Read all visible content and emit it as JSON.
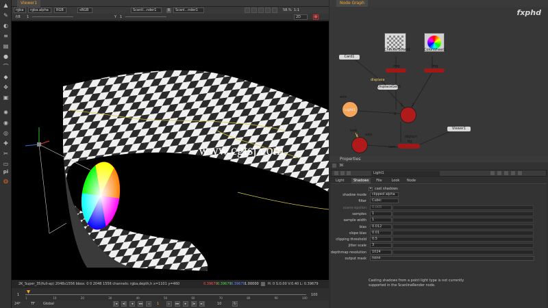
{
  "toolbar": {
    "icons": [
      "pointer-icon",
      "brush-icon",
      "palette-icon",
      "channel-icon",
      "gradient-icon",
      "sphere-icon",
      "curve-icon",
      "merge-icon",
      "transform-icon",
      "3d-icon",
      "particle-icon",
      "deep-icon",
      "views-icon",
      "metadata-icon",
      "toolsets-icon",
      "other-icon",
      "pi-icon",
      "nuke-icon"
    ]
  },
  "viewer": {
    "tab_label": "Viewer1",
    "controls": {
      "layer": "rgba",
      "channel": "rgba.alpha",
      "display": "RGB",
      "colorspace": "sRGB",
      "input_a": "ScanlI...nder1",
      "input_b_letter": "B",
      "input_b": "Scanl...nder1",
      "zoom_label": "58.%",
      "scale": "1:1",
      "gain_label": "f/8",
      "gain_value": "1",
      "gamma_label": "Y",
      "gamma_value": "1",
      "view_mode": "2D"
    },
    "info_bar": {
      "format": "2K_Super_35(full-ap) 2048x1556  bbox: 0 0 2048 1556 channels: rgba,depth,h  x=1101 y=460",
      "r": "0.39679",
      "g": "0.39679",
      "b": "0.39679",
      "a": "1.00000",
      "hsv": "H:   0 S:0.00 V:0.40  L: 0.39679"
    },
    "watermark": "www.cgtsj.com"
  },
  "timeline": {
    "ticks": [
      "1",
      "10",
      "20",
      "30",
      "40",
      "50",
      "60",
      "70",
      "80",
      "90",
      "100"
    ],
    "start": "1",
    "end": "100",
    "fps": "24*",
    "tf": "TF",
    "global": "Global",
    "frame": "1",
    "step": "10"
  },
  "node_graph": {
    "tab_label": "Node Graph",
    "brand": "fxphd",
    "nodes": {
      "noise": "Noise1",
      "checkerboard": "CheckerBoard1",
      "colorwheel": "ColorWheel1",
      "card": "Card1",
      "displace": "DisplaceGeo1",
      "img1": "img",
      "img2": "img",
      "light": "Light1",
      "axis": "axis",
      "look": "look",
      "scene": "Scene1",
      "render": "ScanlineRender1",
      "viewer": "Viewer1"
    },
    "labels": {
      "displace": "displace",
      "obj_scn": "obj/scn",
      "bg": "bg",
      "cam": "cam",
      "num1": "1",
      "num2": "2",
      "num3": "3",
      "num0": "0"
    }
  },
  "properties": {
    "tab_label": "Properties",
    "count": "3K",
    "node_name": "Light1",
    "tabs": [
      "Light",
      "Shadows",
      "File",
      "Look",
      "Node"
    ],
    "active_tab": "Shadows",
    "cast_shadows_label": "cast shadows",
    "cast_shadows": true,
    "rows": [
      {
        "label": "shadow mode",
        "value": "clipped alpha",
        "kind": "dropdown"
      },
      {
        "label": "filter",
        "value": "Cubic",
        "kind": "dropdown"
      },
      {
        "label": "scene epsilon",
        "value": "0.005",
        "kind": "slider",
        "disabled": true
      },
      {
        "label": "samples",
        "value": "1",
        "kind": "slider"
      },
      {
        "label": "sample width",
        "value": "1",
        "kind": "slider"
      },
      {
        "label": "bias",
        "value": "0.012",
        "kind": "slider"
      },
      {
        "label": "slope bias",
        "value": "0.01",
        "kind": "slider"
      },
      {
        "label": "clipping threshold",
        "value": "0.5",
        "kind": "slider"
      },
      {
        "label": "jitter scale",
        "value": "3",
        "kind": "slider"
      },
      {
        "label": "depthmap resolution",
        "value": "1024",
        "kind": "slider"
      },
      {
        "label": "output mask",
        "value": "none",
        "kind": "wide"
      }
    ],
    "note": "Casting shadows from a point light type is not currently supported in the ScanlineRender node."
  },
  "colors": {
    "accent_orange": "#f7a62c",
    "render_red": "#b11a1a",
    "light_orange": "#f4a55a",
    "panel_bg": "#2f2f2f",
    "viewport_bg": "#000000"
  }
}
